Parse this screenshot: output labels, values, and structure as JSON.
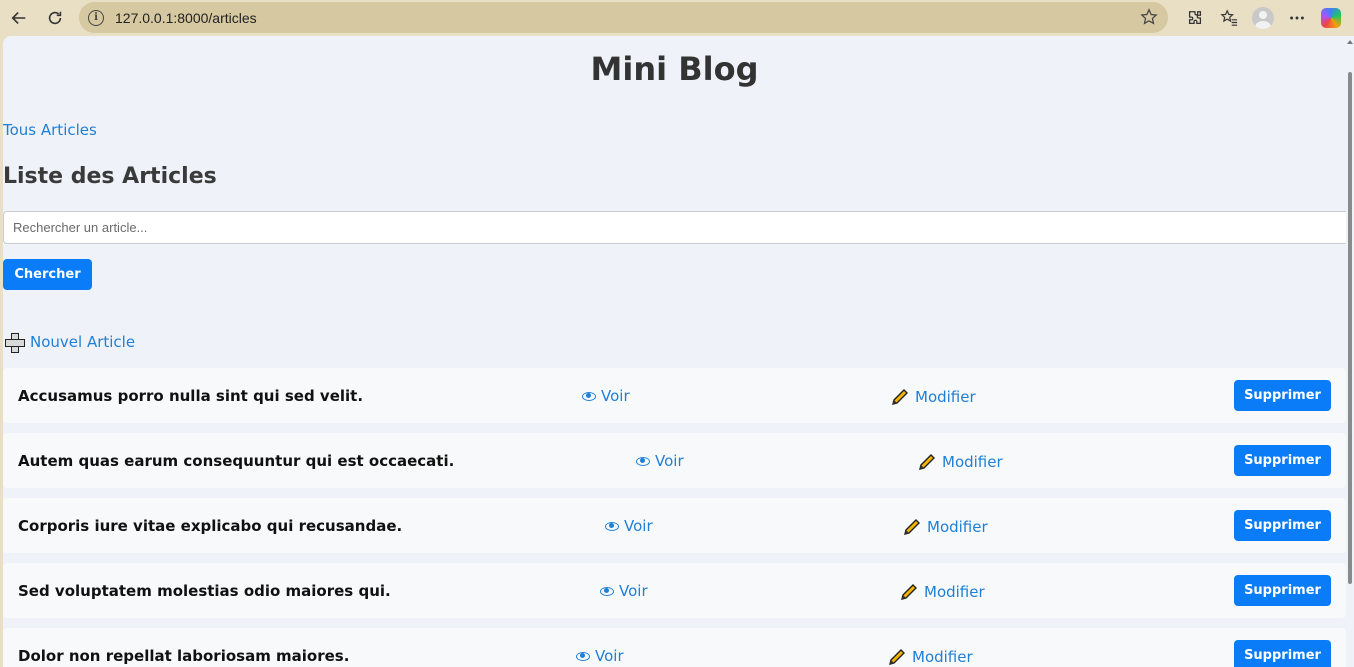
{
  "browser": {
    "url": "127.0.0.1:8000/articles"
  },
  "site": {
    "title": "Mini Blog",
    "nav_link": "Tous Articles"
  },
  "main": {
    "section_title": "Liste des Articles",
    "search": {
      "placeholder": "Rechercher un article...",
      "value": ""
    },
    "search_button": "Chercher",
    "new_article": "Nouvel Article",
    "view_label": "Voir",
    "edit_label": "Modifier",
    "delete_label": "Supprimer",
    "articles": [
      {
        "title": "Accusamus porro nulla sint qui sed velit."
      },
      {
        "title": "Autem quas earum consequuntur qui est occaecati."
      },
      {
        "title": "Corporis iure vitae explicabo qui recusandae."
      },
      {
        "title": "Sed voluptatem molestias odio maiores qui."
      },
      {
        "title": "Dolor non repellat laboriosam maiores."
      }
    ]
  },
  "colors": {
    "accent": "#0b7cf7",
    "link": "#1f7fd6",
    "page_bg": "#eff2f8",
    "row_bg": "#f8f9fa"
  },
  "icons": [
    "back-icon",
    "refresh-icon",
    "info-icon",
    "star-icon",
    "extensions-icon",
    "favorites-icon",
    "profile-icon",
    "more-icon",
    "copilot-icon",
    "plus-icon",
    "eye-icon",
    "pencil-icon"
  ]
}
